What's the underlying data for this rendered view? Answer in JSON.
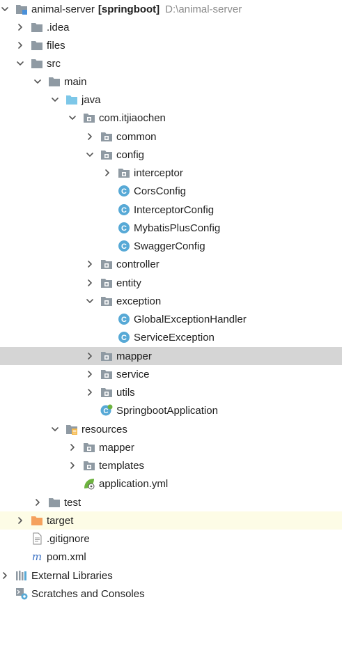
{
  "project": {
    "name": "animal-server",
    "module": "[springboot]",
    "path": "D:\\animal-server"
  },
  "tree": {
    "idea": ".idea",
    "files": "files",
    "src": "src",
    "main": "main",
    "java": "java",
    "package": "com.itjiaochen",
    "common": "common",
    "config": "config",
    "interceptor": "interceptor",
    "cors_config": "CorsConfig",
    "interceptor_config": "InterceptorConfig",
    "mybatis_config": "MybatisPlusConfig",
    "swagger_config": "SwaggerConfig",
    "controller": "controller",
    "entity": "entity",
    "exception": "exception",
    "global_handler": "GlobalExceptionHandler",
    "service_exception": "ServiceException",
    "mapper": "mapper",
    "service": "service",
    "utils": "utils",
    "app": "SpringbootApplication",
    "resources": "resources",
    "res_mapper": "mapper",
    "templates": "templates",
    "app_yml": "application.yml",
    "test": "test",
    "target": "target",
    "gitignore": ".gitignore",
    "pom": "pom.xml",
    "external_libraries": "External Libraries",
    "scratches": "Scratches and Consoles"
  },
  "colors": {
    "folder": "#8f9aa3",
    "source_folder": "#7dc7e8",
    "target_folder": "#f5a15d",
    "class_badge": "#57a9d6",
    "selected_row": "#d5d5d5",
    "target_row": "#fdfce6"
  }
}
